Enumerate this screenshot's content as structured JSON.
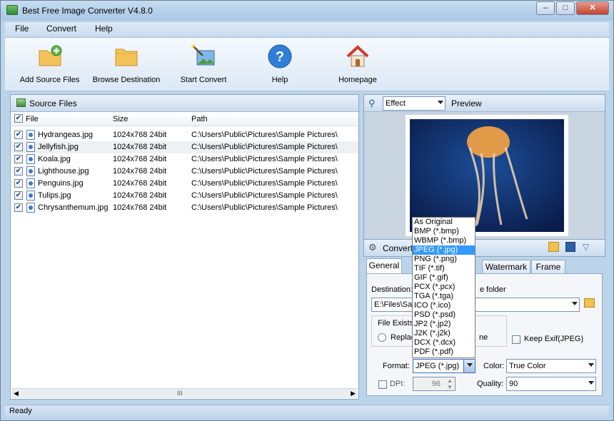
{
  "window": {
    "title": "Best Free Image Converter V4.8.0",
    "controls": {
      "minimize": "–",
      "maximize": "□",
      "close": "✕"
    }
  },
  "menu": {
    "file": "File",
    "convert": "Convert",
    "help": "Help"
  },
  "toolbar": {
    "add_source": "Add Source Files",
    "browse_dest": "Browse Destination",
    "start_convert": "Start Convert",
    "help": "Help",
    "homepage": "Homepage"
  },
  "source_panel": {
    "title": "Source Files",
    "columns": [
      "File",
      "Size",
      "Path"
    ],
    "rows": [
      {
        "file": "Hydrangeas.jpg",
        "size": "1024x768  24bit",
        "path": "C:\\Users\\Public\\Pictures\\Sample Pictures\\"
      },
      {
        "file": "Jellyfish.jpg",
        "size": "1024x768  24bit",
        "path": "C:\\Users\\Public\\Pictures\\Sample Pictures\\"
      },
      {
        "file": "Koala.jpg",
        "size": "1024x768  24bit",
        "path": "C:\\Users\\Public\\Pictures\\Sample Pictures\\"
      },
      {
        "file": "Lighthouse.jpg",
        "size": "1024x768  24bit",
        "path": "C:\\Users\\Public\\Pictures\\Sample Pictures\\"
      },
      {
        "file": "Penguins.jpg",
        "size": "1024x768  24bit",
        "path": "C:\\Users\\Public\\Pictures\\Sample Pictures\\"
      },
      {
        "file": "Tulips.jpg",
        "size": "1024x768  24bit",
        "path": "C:\\Users\\Public\\Pictures\\Sample Pictures\\"
      },
      {
        "file": "Chrysanthemum.jpg",
        "size": "1024x768  24bit",
        "path": "C:\\Users\\Public\\Pictures\\Sample Pictures\\"
      }
    ],
    "scroll_grip": "III"
  },
  "preview": {
    "effect_value": "Effect",
    "preview_label": "Preview"
  },
  "convert_bar": {
    "label": "Convert"
  },
  "tabs": {
    "general": "General",
    "watermark": "Watermark",
    "frame": "Frame"
  },
  "general": {
    "destination_label": "Destination:",
    "destination_suffix": "e folder",
    "destination_value": "E:\\Files\\Sa",
    "file_exists_label": "File Exists",
    "replace_option": "Replac",
    "rename_fragment": "ne",
    "keep_exif": "Keep Exif(JPEG)",
    "format_label": "Format:",
    "format_value": "JPEG (*.jpg)",
    "color_label": "Color:",
    "color_value": "True Color",
    "dpi_label": "DPI:",
    "dpi_value": "96",
    "quality_label": "Quality:",
    "quality_value": "90"
  },
  "format_options": [
    "As Original",
    "BMP (*.bmp)",
    "WBMP (*.bmp)",
    "JPEG (*.jpg)",
    "PNG (*.png)",
    "TIF (*.tif)",
    "GIF (*.gif)",
    "PCX (*.pcx)",
    "TGA (*.tga)",
    "ICO (*.ico)",
    "PSD (*.psd)",
    "JP2 (*.jp2)",
    "J2K (*.j2k)",
    "DCX (*.dcx)",
    "PDF (*.pdf)"
  ],
  "format_selected_index": 3,
  "status": {
    "text": "Ready"
  }
}
